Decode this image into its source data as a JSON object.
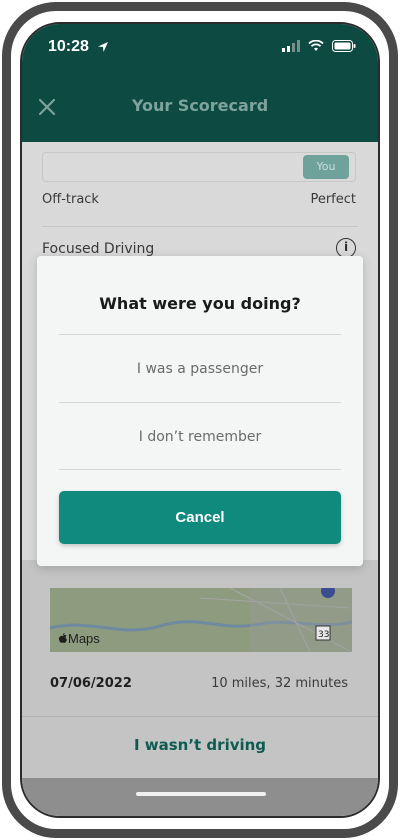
{
  "status_bar": {
    "time": "10:28"
  },
  "header": {
    "title": "Your Scorecard",
    "close_icon": "close-icon"
  },
  "scorecard": {
    "you_chip": "You",
    "off_track_label": "Off-track",
    "perfect_label": "Perfect",
    "focused_driving_label": "Focused Driving"
  },
  "trip": {
    "map_label": "Maps",
    "date": "07/06/2022",
    "stats": "10 miles, 32 minutes",
    "not_driving_label": "I wasn’t driving"
  },
  "modal": {
    "title": "What were you doing?",
    "options": [
      "I was a passenger",
      "I don’t remember"
    ],
    "cancel_label": "Cancel"
  },
  "colors": {
    "header_bg": "#0d4a42",
    "primary_button": "#0f8a7d",
    "accent_text": "#0e5b52"
  }
}
